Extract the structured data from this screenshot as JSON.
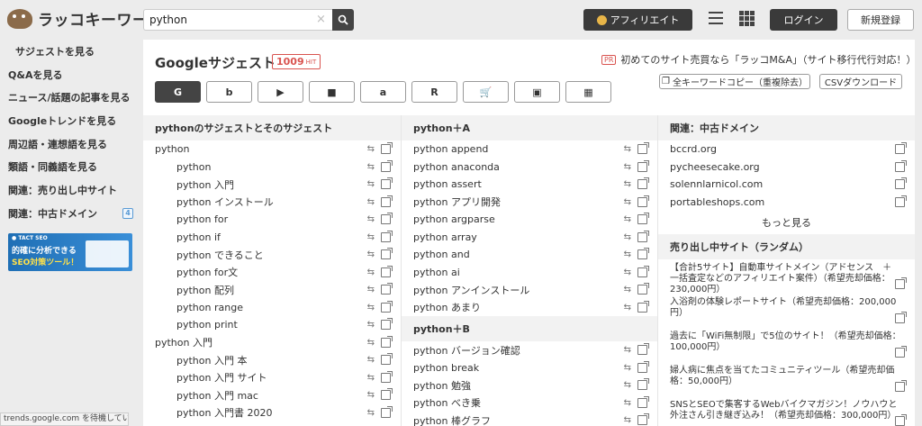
{
  "header": {
    "logo_text": "ラッコキーワード",
    "search_value": "python",
    "search_placeholder": "",
    "clear": "×",
    "affiliate": "アフィリエイト",
    "login": "ログイン",
    "register": "新規登録"
  },
  "sidebar": {
    "items": [
      "サジェストを見る",
      "Q&Aを見る",
      "ニュース/話題の記事を見る",
      "Googleトレンドを見る",
      "周辺語・連想語を見る",
      "類語・同義語を見る",
      "関連：売り出し中サイト",
      "関連：中古ドメイン"
    ],
    "badge": "4",
    "banner_small": "● TACT SEO",
    "banner_line1": "的確に分析できる",
    "banner_line2": "SEO対策ツール！"
  },
  "status_text": "trends.google.com を待機していま...",
  "main": {
    "title": "Googleサジェスト",
    "hit_count": "1009",
    "hit_label": "HIT",
    "pr_tag": "PR",
    "pr_text": "初めてのサイト売買なら「ラッコM&A」（サイト移行代行対応！）",
    "copy_btn": "全キーワードコピー（重複除去）",
    "csv_btn": "CSVダウンロード",
    "sources": [
      "G",
      "b",
      "▶",
      "■",
      "a",
      "R",
      "🛒",
      "▣",
      "▦"
    ]
  },
  "col1": {
    "head": "pythonのサジェストとそのサジェスト",
    "rows": [
      {
        "t": "python",
        "sub": false
      },
      {
        "t": "python",
        "sub": true
      },
      {
        "t": "python 入門",
        "sub": true
      },
      {
        "t": "python インストール",
        "sub": true
      },
      {
        "t": "python for",
        "sub": true
      },
      {
        "t": "python if",
        "sub": true
      },
      {
        "t": "python できること",
        "sub": true
      },
      {
        "t": "python for文",
        "sub": true
      },
      {
        "t": "python 配列",
        "sub": true
      },
      {
        "t": "python range",
        "sub": true
      },
      {
        "t": "python print",
        "sub": true
      },
      {
        "t": "python 入門",
        "sub": false
      },
      {
        "t": "python 入門 本",
        "sub": true
      },
      {
        "t": "python 入門 サイト",
        "sub": true
      },
      {
        "t": "python 入門 mac",
        "sub": true
      },
      {
        "t": "python 入門書 2020",
        "sub": true
      }
    ]
  },
  "col2": {
    "head_a": "python＋A",
    "rows_a": [
      "python append",
      "python anaconda",
      "python assert",
      "python アプリ開発",
      "python argparse",
      "python array",
      "python and",
      "python ai",
      "python アンインストール",
      "python あまり"
    ],
    "head_b": "python＋B",
    "rows_b": [
      "python バージョン確認",
      "python break",
      "python 勉強",
      "python べき乗",
      "python 棒グラフ"
    ]
  },
  "col3": {
    "head_dom": "関連：中古ドメイン",
    "domains": [
      "bccrd.org",
      "pycheesecake.org",
      "solennlarnicol.com",
      "portableshops.com"
    ],
    "more": "もっと見る",
    "head_sites": "売り出し中サイト（ランダム）",
    "sites": [
      "【合計5サイト】自動車サイトメイン（アドセンス　＋　一括査定などのアフィリエイト案件）（希望売却価格：230,000円）",
      "入浴剤の体験レポートサイト（希望売却価格：200,000円）",
      "過去に「WiFi無制限」で5位のサイト！（希望売却価格：100,000円）",
      "婦人病に焦点を当てたコミュニティツール（希望売却価格：50,000円）",
      "SNSとSEOで集客するWebバイクマガジン！ノウハウと外注さん引き継ぎ込み！（希望売却価格：300,000円）"
    ]
  }
}
